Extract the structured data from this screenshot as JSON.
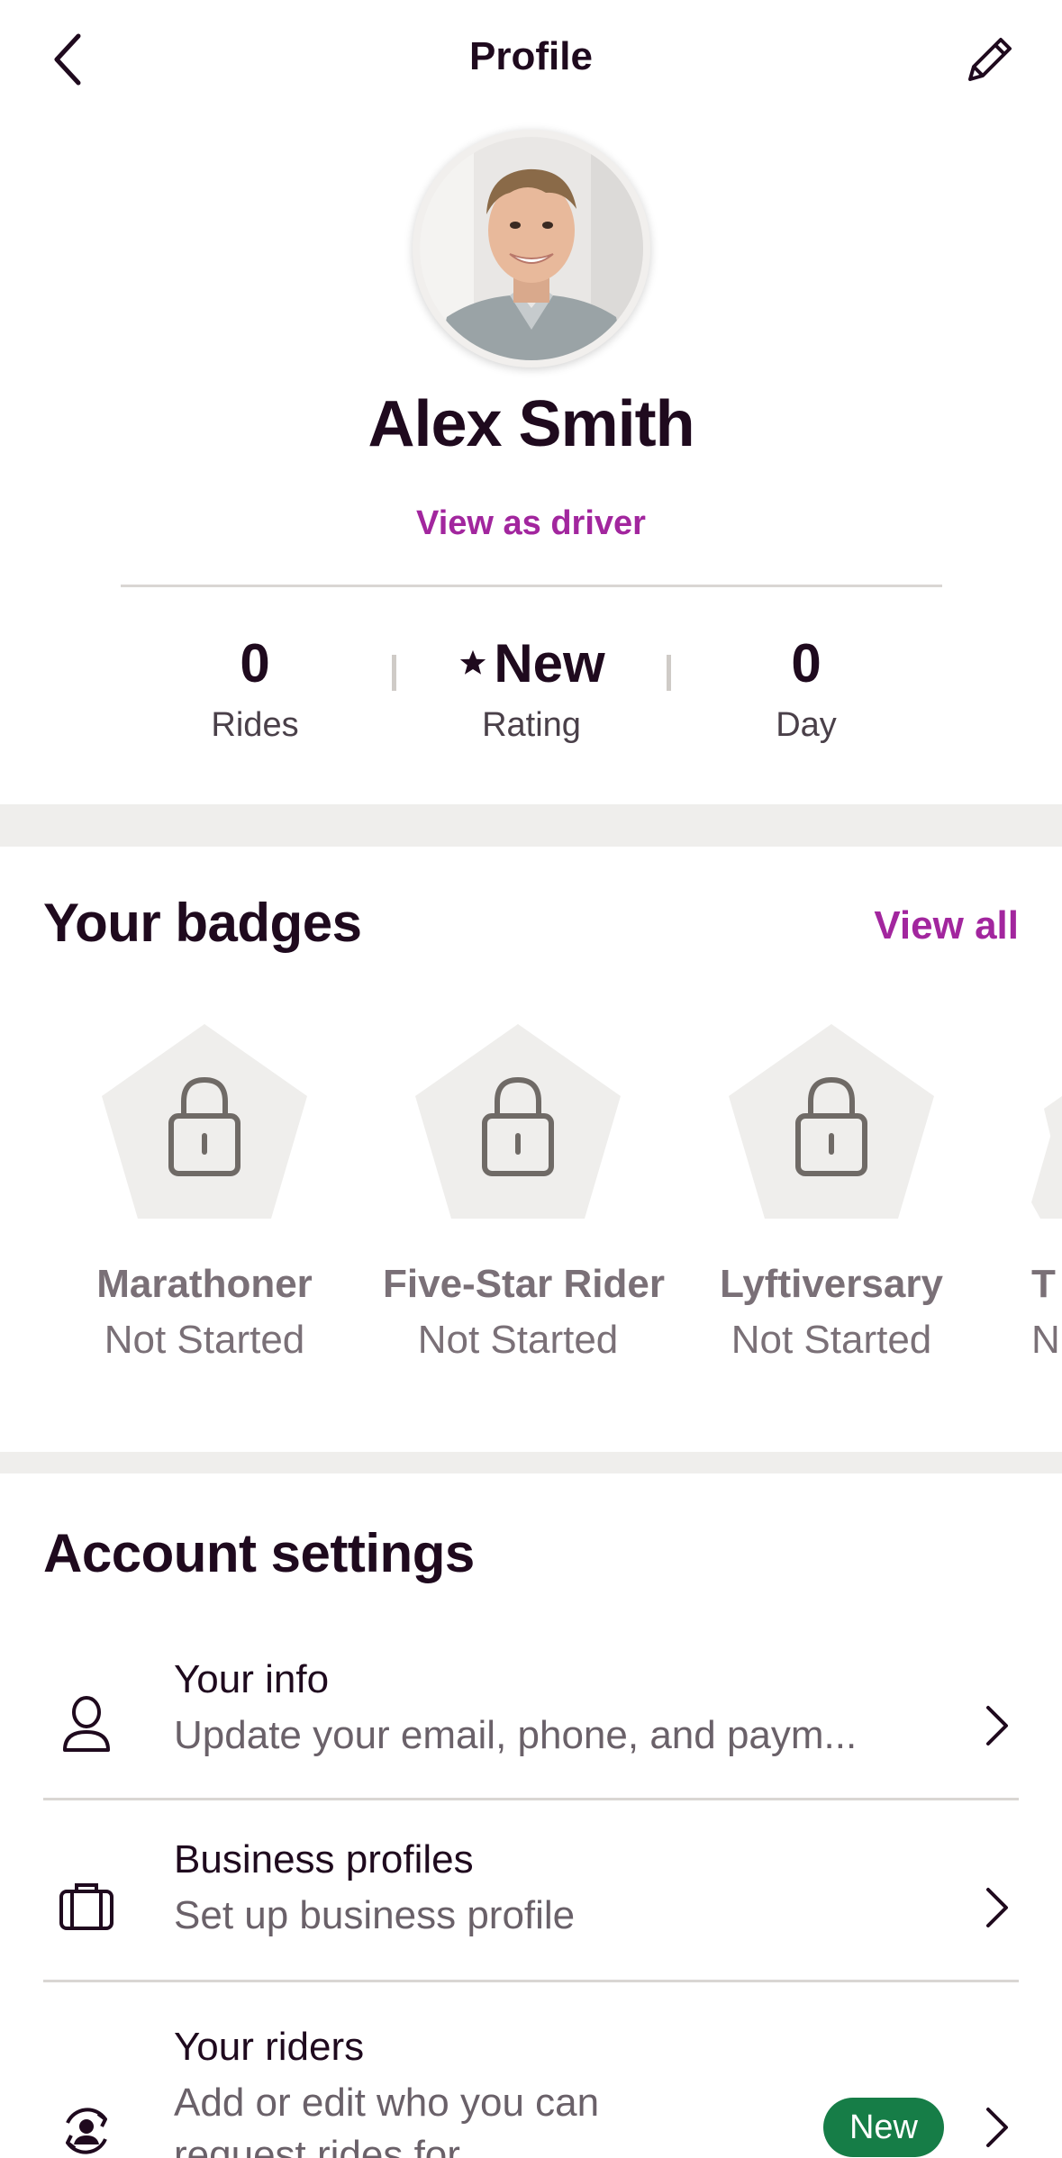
{
  "header": {
    "title": "Profile",
    "back_icon": "chevron-left-icon",
    "edit_icon": "pencil-icon"
  },
  "profile": {
    "name": "Alex Smith",
    "view_as_driver": "View as driver"
  },
  "stats": [
    {
      "value": "0",
      "label": "Rides"
    },
    {
      "value": "New",
      "label": "Rating",
      "icon": "star-icon"
    },
    {
      "value": "0",
      "label": "Day"
    }
  ],
  "badges": {
    "title": "Your badges",
    "view_all": "View all",
    "items": [
      {
        "name": "Marathoner",
        "status": "Not Started"
      },
      {
        "name": "Five-Star Rider",
        "status": "Not Started"
      },
      {
        "name": "Lyftiversary",
        "status": "Not Started"
      },
      {
        "name": "T",
        "status": "N"
      }
    ]
  },
  "account": {
    "title": "Account settings",
    "items": [
      {
        "title": "Your info",
        "subtitle": "Update your email, phone, and paym...",
        "icon": "person-icon"
      },
      {
        "title": "Business profiles",
        "subtitle": "Set up business profile",
        "icon": "briefcase-icon"
      },
      {
        "title": "Your riders",
        "subtitle": "Add or edit who you can",
        "subtitle2": "request rides for",
        "icon": "riders-icon",
        "badge": "New"
      }
    ]
  },
  "colors": {
    "accent": "#a2269e",
    "text": "#1f0a1e",
    "badge_bg": "#efeeec",
    "new_badge": "#167d47"
  }
}
